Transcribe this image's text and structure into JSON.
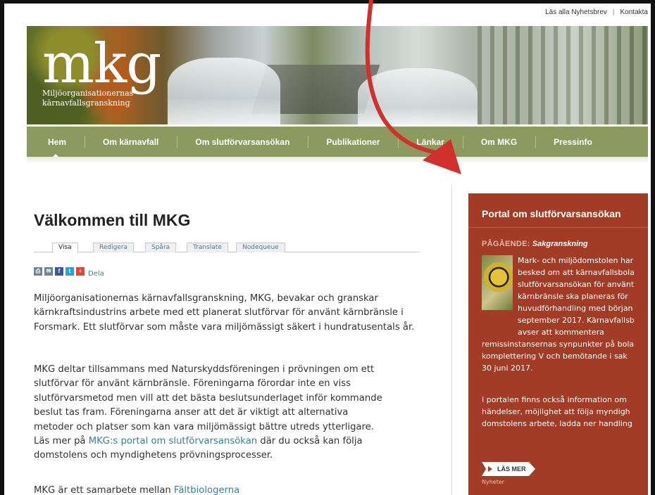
{
  "toplinks": {
    "items": [
      "Läs alla Nyhetsbrev",
      "Kontakta"
    ],
    "separator": "|"
  },
  "header": {
    "logo": "mkg",
    "subtitle_line1": "Miljöorganisationernas",
    "subtitle_line2": "kärnavfallsgranskning"
  },
  "nav": {
    "items": [
      {
        "label": "Hem",
        "active": true
      },
      {
        "label": "Om kärnavfall"
      },
      {
        "label": "Om slutförvarsansökan"
      },
      {
        "label": "Publikationer"
      },
      {
        "label": "Länkar"
      },
      {
        "label": "Om MKG"
      },
      {
        "label": "Pressinfo"
      }
    ]
  },
  "main": {
    "title": "Välkommen till MKG",
    "tabs": [
      "Visa",
      "Redigera",
      "Spåra",
      "Translate",
      "Nodequeue"
    ],
    "share_label": "Dela",
    "share_icons": [
      "print-icon",
      "email-icon",
      "facebook-icon",
      "twitter-icon",
      "addthis-plus-icon"
    ],
    "p1": "Miljöorganisationernas kärnavfallsgranskning, MKG, bevakar och granskar kärnkraftsindustrins arbete med ett planerat slutförvar för använt kärnbränsle i Forsmark. Ett slutförvar som måste vara miljömässigt säkert i hundratusentals år.",
    "p2_lines": [
      "MKG deltar tillsammans med Naturskyddsföreningen i prövningen om ett",
      "slutförvar för använt kärnbränsle. Föreningarna förordar inte en viss",
      "slutförvarsmetod men vill att det bästa beslutsunderlaget inför kommande",
      "beslut tas fram. Föreningarna anser att det är viktigt att alternativa",
      "metoder och platser som kan vara miljömässigt bättre utreds ytterligare."
    ],
    "p2_last_prefix": "Läs mer på ",
    "p2_link": "MKG:s portal om slutförvarsansökan",
    "p2_last_suffix": " där du också kan följa",
    "p2_final": "domstolens och myndighetens prövningsprocesser.",
    "p3_prefix": "MKG är ett samarbete mellan ",
    "p3_link": "Fältbiologerna"
  },
  "sidebar": {
    "title": "Portal om slutförvarsansökan",
    "status_label": "PÅGÅENDE:",
    "status_value": "Sakgranskning",
    "indent_lines": [
      "Mark- och miljödomstolen har",
      "besked om att kärnavfallsbola",
      "slutförvarsansökan för använt",
      "kärnbränsle ska planeras för",
      "huvudförhandling med början",
      "september 2017. Kärnavfallsb",
      "avser att kommentera"
    ],
    "full_lines": [
      "remissinstansernas synpunkter på bola",
      "komplettering V och bemötande i sak",
      "30 juni 2017."
    ],
    "full_lines2": [
      "I portalen finns också information om",
      "händelser, möjlighet att följa myndigh",
      "domstolens arbete, ladda ner handling"
    ],
    "read_more": "LÄS MER",
    "tiny": "Nyheter"
  },
  "colors": {
    "nav_bg": "#8c9a60",
    "sidebar_bg": "#a33c26",
    "link": "#3b7d96",
    "annotation_arrow": "#d0312d"
  }
}
